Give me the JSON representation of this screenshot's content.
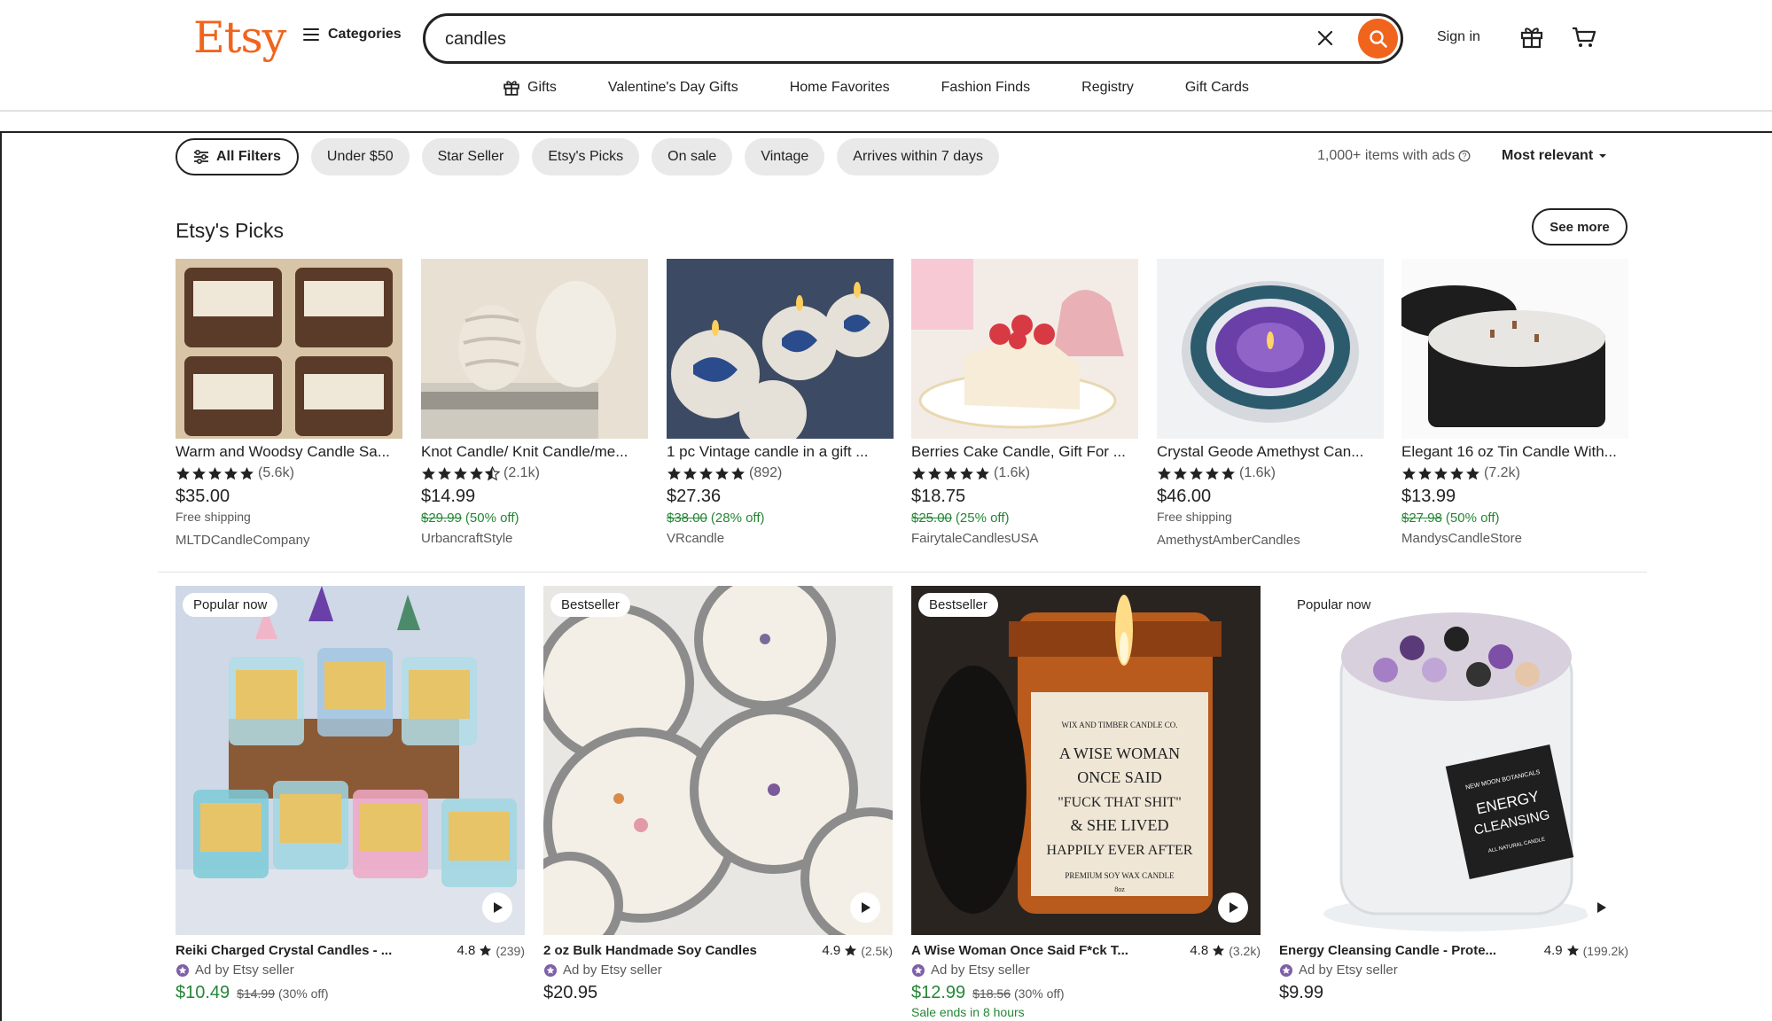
{
  "header": {
    "logo": "Etsy",
    "categories_label": "Categories",
    "search_value": "candles",
    "signin_label": "Sign in"
  },
  "subnav": [
    {
      "label": "Gifts",
      "icon": "gift-icon"
    },
    {
      "label": "Valentine's Day Gifts"
    },
    {
      "label": "Home Favorites"
    },
    {
      "label": "Fashion Finds"
    },
    {
      "label": "Registry"
    },
    {
      "label": "Gift Cards"
    }
  ],
  "filters": {
    "all_filters": "All Filters",
    "chips": [
      "Under $50",
      "Star Seller",
      "Etsy's Picks",
      "On sale",
      "Vintage",
      "Arrives within 7 days"
    ],
    "result_count": "1,000+ items with ads",
    "sort_label": "Most relevant"
  },
  "picks": {
    "title": "Etsy's Picks",
    "see_more": "See more",
    "items": [
      {
        "title": "Warm and Woodsy Candle Sa...",
        "stars": 5,
        "reviews": "(5.6k)",
        "price": "$35.00",
        "extra": "Free shipping",
        "shop": "MLTDCandleCompany",
        "img_colors": [
          "#d8c4a6",
          "#5a3a28"
        ]
      },
      {
        "title": "Knot Candle/ Knit Candle/me...",
        "stars": 4.5,
        "reviews": "(2.1k)",
        "price": "$14.99",
        "orig_price": "$29.99",
        "discount": "(50% off)",
        "shop": "UrbancraftStyle",
        "img_colors": [
          "#e8e0d2",
          "#b9ac98"
        ]
      },
      {
        "title": "1 pc Vintage candle in a gift ...",
        "stars": 5,
        "reviews": "(892)",
        "price": "$27.36",
        "orig_price": "$38.00",
        "discount": "(28% off)",
        "shop": "VRcandle",
        "img_colors": [
          "#5a6b86",
          "#e6e1d8"
        ]
      },
      {
        "title": "Berries Cake Candle, Gift For ...",
        "stars": 5,
        "reviews": "(1.6k)",
        "price": "$18.75",
        "orig_price": "$25.00",
        "discount": "(25% off)",
        "shop": "FairytaleCandlesUSA",
        "img_colors": [
          "#f3ece6",
          "#d83a44"
        ]
      },
      {
        "title": "Crystal Geode Amethyst Can...",
        "stars": 5,
        "reviews": "(1.6k)",
        "price": "$46.00",
        "extra": "Free shipping",
        "shop": "AmethystAmberCandles",
        "img_colors": [
          "#6a3fa8",
          "#2c5b6e"
        ]
      },
      {
        "title": "Elegant 16 oz Tin Candle With...",
        "stars": 5,
        "reviews": "(7.2k)",
        "price": "$13.99",
        "orig_price": "$27.98",
        "discount": "(50% off)",
        "shop": "MandysCandleStore",
        "img_colors": [
          "#f2f2f2",
          "#1d1d1d"
        ]
      }
    ]
  },
  "listings": [
    {
      "badge": "Popular now",
      "title": "Reiki Charged Crystal Candles - ...",
      "rating": "4.8",
      "reviews": "(239)",
      "ad_label": "Ad by Etsy seller",
      "price": "$10.49",
      "orig_price": "$14.99",
      "discount": "(30% off)",
      "on_sale": true,
      "img_colors": [
        "#cfd8e6",
        "#e8c468"
      ]
    },
    {
      "badge": "Bestseller",
      "title": "2 oz Bulk Handmade Soy Candles",
      "rating": "4.9",
      "reviews": "(2.5k)",
      "ad_label": "Ad by Etsy seller",
      "price": "$20.95",
      "on_sale": false,
      "img_colors": [
        "#e9e7e3",
        "#8c8c8c"
      ]
    },
    {
      "badge": "Bestseller",
      "title": "A Wise Woman Once Said F*ck T...",
      "rating": "4.8",
      "reviews": "(3.2k)",
      "ad_label": "Ad by Etsy seller",
      "price": "$12.99",
      "orig_price": "$18.56",
      "discount": "(30% off)",
      "sale_ends": "Sale ends in 8 hours",
      "on_sale": true,
      "img_colors": [
        "#2a2421",
        "#c8621c"
      ],
      "label_text": [
        "WIX AND TIMBER CANDLE CO.",
        "A WISE WOMAN",
        "ONCE SAID",
        "\"FUCK THAT SHIT\"",
        "& SHE LIVED",
        "HAPPILY EVER AFTER",
        "PREMIUM SOY WAX CANDLE",
        "8oz"
      ]
    },
    {
      "badge": "Popular now",
      "title": "Energy Cleansing Candle - Prote...",
      "rating": "4.9",
      "reviews": "(199.2k)",
      "ad_label": "Ad by Etsy seller",
      "price": "$9.99",
      "on_sale": false,
      "img_colors": [
        "#f4f4f4",
        "#5b3a7a"
      ],
      "label_text": [
        "NEW MOON BOTANICALS",
        "ENERGY",
        "CLEANSING",
        "ALL NATURAL CANDLE"
      ]
    }
  ]
}
